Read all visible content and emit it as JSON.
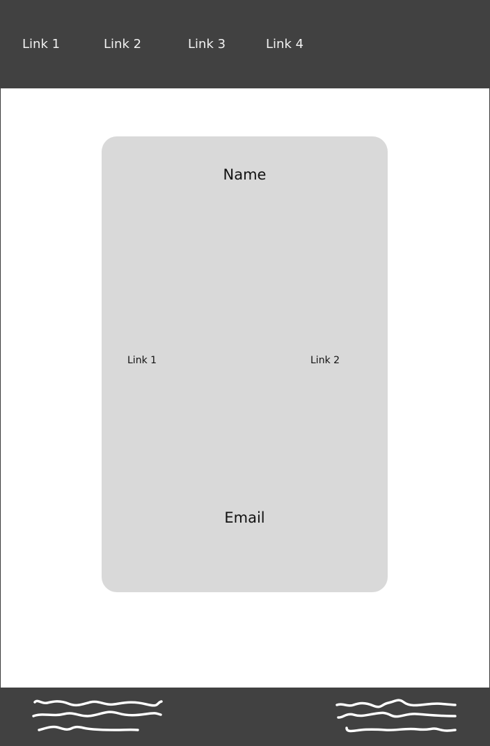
{
  "nav": {
    "links": [
      "Link 1",
      "Link 2",
      "Link 3",
      "Link 4"
    ]
  },
  "card": {
    "title": "Name",
    "links": [
      "Link 1",
      "Link 2"
    ],
    "footer_label": "Email"
  },
  "footer": {
    "left_scribble": "scribble-placeholder",
    "right_scribble": "scribble-placeholder"
  },
  "colors": {
    "header_bg": "#414141",
    "card_bg": "#d9d9d9",
    "page_bg": "#ffffff",
    "nav_text": "#f2f2f2",
    "card_text": "#111111"
  }
}
